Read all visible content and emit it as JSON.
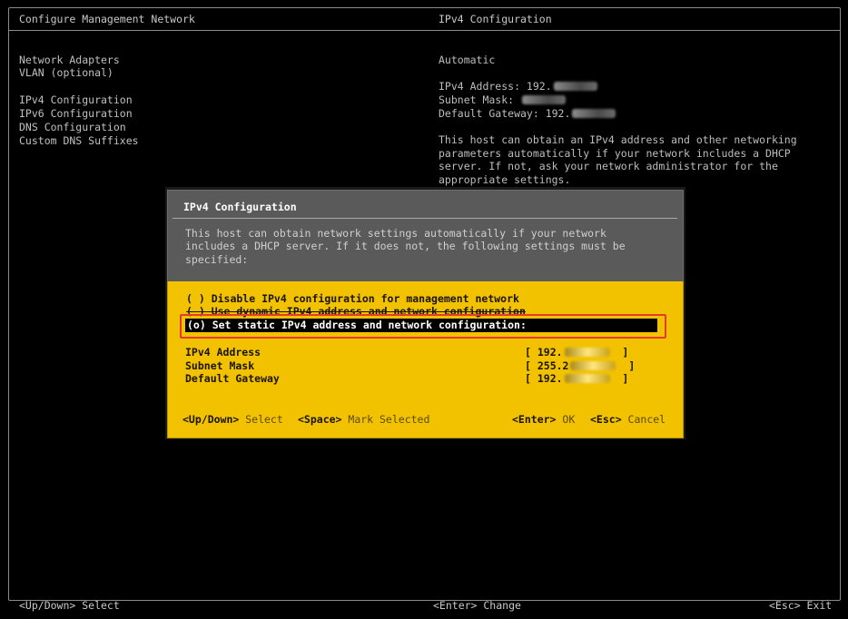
{
  "header": {
    "left_title": "Configure Management Network",
    "right_title": "IPv4 Configuration"
  },
  "menu": [
    {
      "label": "Network Adapters"
    },
    {
      "label": "VLAN (optional)"
    },
    {
      "label": "IPv4 Configuration"
    },
    {
      "label": "IPv6 Configuration"
    },
    {
      "label": "DNS Configuration"
    },
    {
      "label": "Custom DNS Suffixes"
    }
  ],
  "info": {
    "mode": "Automatic",
    "ipv4_address_label": "IPv4 Address: 192.",
    "subnet_mask_label": "Subnet Mask: ",
    "gateway_label": "Default Gateway: 192.",
    "description": [
      "This host can obtain an IPv4 address and other networking",
      "parameters automatically if your network includes a DHCP",
      "server. If not, ask your network administrator for the",
      "appropriate settings."
    ]
  },
  "dialog": {
    "title": "IPv4 Configuration",
    "description": [
      "This host can obtain network settings automatically if your network",
      "includes a DHCP server. If it does not, the following settings must be",
      "specified:"
    ],
    "options": [
      {
        "label": "( ) Disable IPv4 configuration for management network"
      },
      {
        "label": "( ) Use dynamic IPv4 address and network configuration"
      },
      {
        "label": "(o) Set static IPv4 address and network configuration:"
      }
    ],
    "fields": [
      {
        "label": "IPv4 Address",
        "value_prefix": "[ 192.",
        "value_suffix": "  ]"
      },
      {
        "label": "Subnet Mask",
        "value_prefix": "[ 255.2",
        "value_suffix": "  ]"
      },
      {
        "label": "Default Gateway",
        "value_prefix": "[ 192.",
        "value_suffix": "  ]"
      }
    ],
    "hints": {
      "updown_key": "<Up/Down>",
      "updown_text": " Select",
      "space_key": "<Space>",
      "space_text": " Mark Selected",
      "enter_key": "<Enter>",
      "enter_text": " OK",
      "esc_key": "<Esc>",
      "esc_text": " Cancel"
    }
  },
  "footer": {
    "left": "<Up/Down> Select",
    "center": "<Enter> Change",
    "right": "<Esc> Exit"
  },
  "colors": {
    "background": "#000000",
    "dialog_yellow": "#f2c200",
    "dialog_header_gray": "#5a5a5a",
    "highlight_red": "#e53a2f"
  }
}
